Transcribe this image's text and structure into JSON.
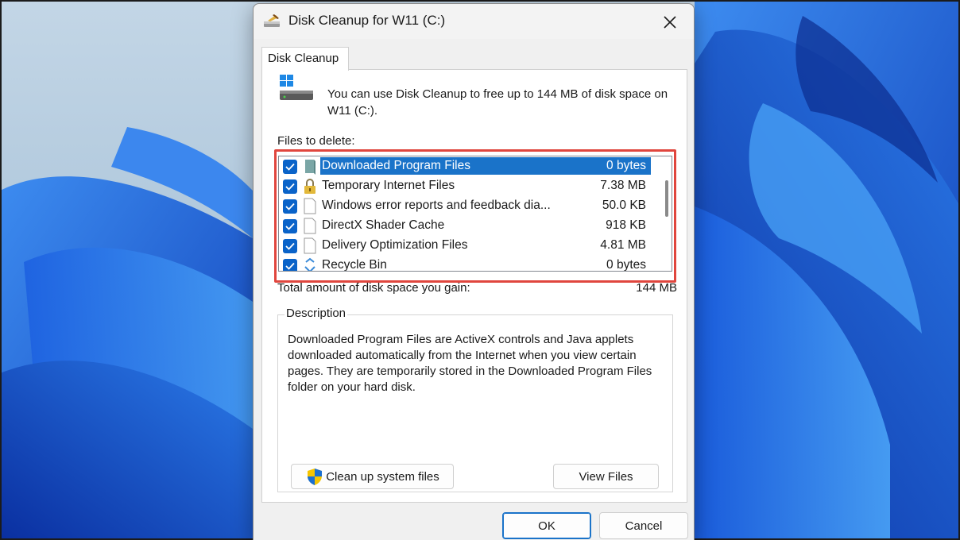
{
  "window": {
    "title": "Disk Cleanup for W11 (C:)",
    "tab_label": "Disk Cleanup"
  },
  "intro": {
    "text": "You can use Disk Cleanup to free up to 144 MB of disk space on W11 (C:)."
  },
  "files": {
    "label": "Files to delete:",
    "items": [
      {
        "name": "Downloaded Program Files",
        "size": "0 bytes",
        "checked": true,
        "selected": true,
        "icon": "folder-icon"
      },
      {
        "name": "Temporary Internet Files",
        "size": "7.38 MB",
        "checked": true,
        "selected": false,
        "icon": "lock-icon"
      },
      {
        "name": "Windows error reports and feedback dia...",
        "size": "50.0 KB",
        "checked": true,
        "selected": false,
        "icon": "file-icon"
      },
      {
        "name": "DirectX Shader Cache",
        "size": "918 KB",
        "checked": true,
        "selected": false,
        "icon": "file-icon"
      },
      {
        "name": "Delivery Optimization Files",
        "size": "4.81 MB",
        "checked": true,
        "selected": false,
        "icon": "file-icon"
      },
      {
        "name": "Recycle Bin",
        "size": "0 bytes",
        "checked": true,
        "selected": false,
        "icon": "recycle-bin-icon"
      }
    ]
  },
  "total": {
    "label": "Total amount of disk space you gain:",
    "value": "144 MB"
  },
  "description": {
    "legend": "Description",
    "text": "Downloaded Program Files are ActiveX controls and Java applets downloaded automatically from the Internet when you view certain pages. They are temporarily stored in the Downloaded Program Files folder on your hard disk."
  },
  "buttons": {
    "cleanup_system_files": "Clean up system files",
    "view_files": "View Files",
    "ok": "OK",
    "cancel": "Cancel"
  },
  "colors": {
    "accent": "#1a73c9",
    "highlight": "#e0463e",
    "checkbox": "#0a63c9"
  }
}
